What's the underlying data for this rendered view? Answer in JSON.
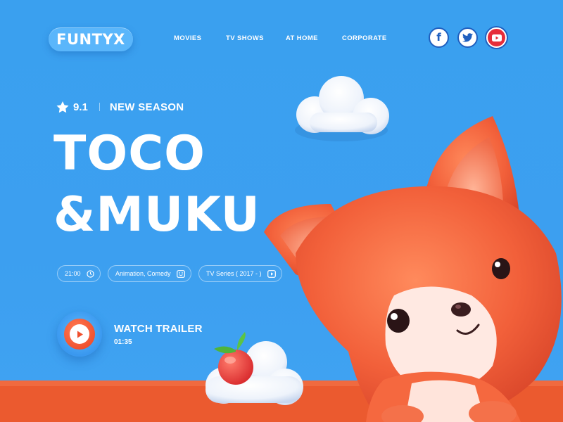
{
  "brand": {
    "logo": "FUNTYX"
  },
  "nav": {
    "items": [
      {
        "label": "MOVIES"
      },
      {
        "label": "TV SHOWS"
      },
      {
        "label": "AT HOME"
      },
      {
        "label": "CORPORATE"
      }
    ]
  },
  "social": {
    "items": [
      {
        "icon": "facebook-icon",
        "label": "f"
      },
      {
        "icon": "twitter-icon"
      },
      {
        "icon": "youtube-icon"
      }
    ]
  },
  "hero": {
    "rating": "9.1",
    "badge": "NEW SEASON",
    "title_line1": "TOCO",
    "title_line2": "&MUKU",
    "meta": [
      {
        "label": "21:00",
        "icon": "clock-icon"
      },
      {
        "label": "Animation, Comedy",
        "icon": "smiley-icon"
      },
      {
        "label": "TV Series ( 2017 - )",
        "icon": "play-small-icon"
      }
    ],
    "trailer": {
      "label": "WATCH TRAILER",
      "duration": "01:35"
    }
  },
  "colors": {
    "background": "#3c9ff0",
    "logo_pill": "#5ab6fb",
    "accent_orange": "#f0502e",
    "ground": "#eb5a2f",
    "social_border": "#1f5fbf",
    "youtube": "#e62d3a"
  }
}
